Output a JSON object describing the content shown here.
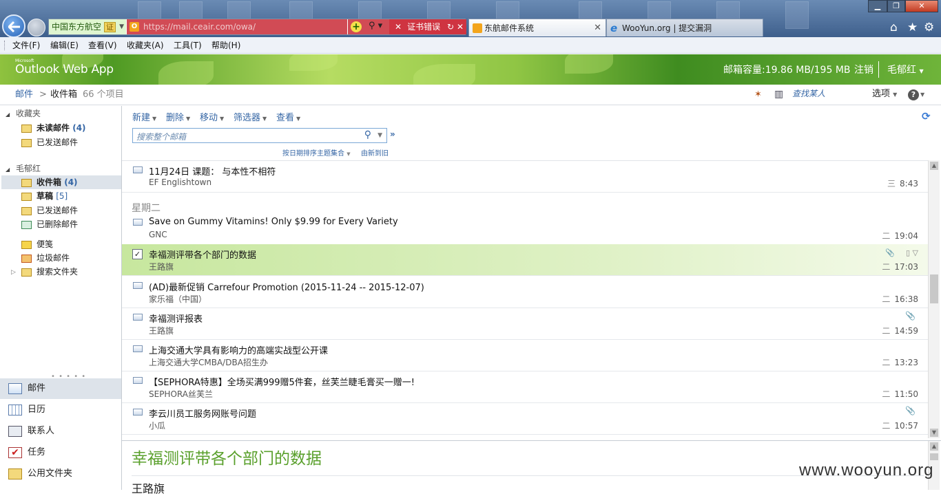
{
  "browser": {
    "site_identity": "中国东方航空",
    "site_badge": "证",
    "url": "https://mail.ceair.com/owa/",
    "cert_error": "证书错误",
    "tabs": [
      {
        "label": "东航邮件系统"
      },
      {
        "label": "WooYun.org | 提交漏洞"
      }
    ]
  },
  "menubar": [
    "文件(F)",
    "编辑(E)",
    "查看(V)",
    "收藏夹(A)",
    "工具(T)",
    "帮助(H)"
  ],
  "owa": {
    "logo_small": "Microsoft",
    "logo": "Outlook Web App",
    "quota": "邮箱容量:19.86 MB/195 MB",
    "logout": "注销",
    "user": "毛郁红"
  },
  "breadcrumb": {
    "root": "邮件",
    "sep": ">",
    "current": "收件箱",
    "count": "66 个项目"
  },
  "header_tools": {
    "find_contacts": "查找某人",
    "options": "选项",
    "help": "?"
  },
  "nav": {
    "favorites": "收藏夹",
    "fav_unread": "未读邮件",
    "fav_unread_count": "(4)",
    "fav_sent": "已发送邮件",
    "mailbox": "毛郁红",
    "inbox": "收件箱",
    "inbox_count": "(4)",
    "drafts": "草稿",
    "drafts_count": "[5]",
    "sent": "已发送邮件",
    "deleted": "已删除邮件",
    "notes": "便笺",
    "junk": "垃圾邮件",
    "search_folders": "搜索文件夹"
  },
  "modules": [
    "邮件",
    "日历",
    "联系人",
    "任务",
    "公用文件夹"
  ],
  "toolbar": [
    "新建",
    "删除",
    "移动",
    "筛选器",
    "查看"
  ],
  "search": {
    "placeholder": "搜索整个邮箱"
  },
  "sort": {
    "by": "按日期排序主题集合",
    "order": "由新到旧"
  },
  "day_header": "星期二",
  "messages": [
    {
      "subject": "11月24日 课题： 与本性不相符",
      "from": "EF Englishtown",
      "time": "8:43",
      "day_mark": "三"
    },
    {
      "subject": "Save on Gummy Vitamins! Only $9.99 for Every Variety",
      "from": "GNC",
      "time": "19:04",
      "day_mark": "二"
    },
    {
      "subject": "幸福测评带各个部门的数据",
      "from": "王路旗",
      "time": "17:03",
      "day_mark": "二",
      "selected": true
    },
    {
      "subject": "(AD)最新促销  Carrefour Promotion (2015-11-24 -- 2015-12-07)",
      "from": "家乐福（中国）",
      "time": "16:38",
      "day_mark": "二"
    },
    {
      "subject": "幸福测评报表",
      "from": "王路旗",
      "time": "14:59",
      "day_mark": "二"
    },
    {
      "subject": "上海交通大学具有影响力的高端实战型公开课",
      "from": "上海交通大学CMBA/DBA招生办",
      "time": "13:23",
      "day_mark": "二"
    },
    {
      "subject": "【SEPHORA特惠】全场买满999赠5件套，丝芙兰睫毛膏买一赠一!",
      "from": "SEPHORA丝芙兰",
      "time": "11:50",
      "day_mark": "二"
    },
    {
      "subject": "李云川员工服务网账号问题",
      "from": "小瓜",
      "time": "10:57",
      "day_mark": "二"
    }
  ],
  "reading_pane": {
    "title": "幸福测评带各个部门的数据",
    "sender": "王路旗"
  },
  "watermark": "www.wooyun.org"
}
